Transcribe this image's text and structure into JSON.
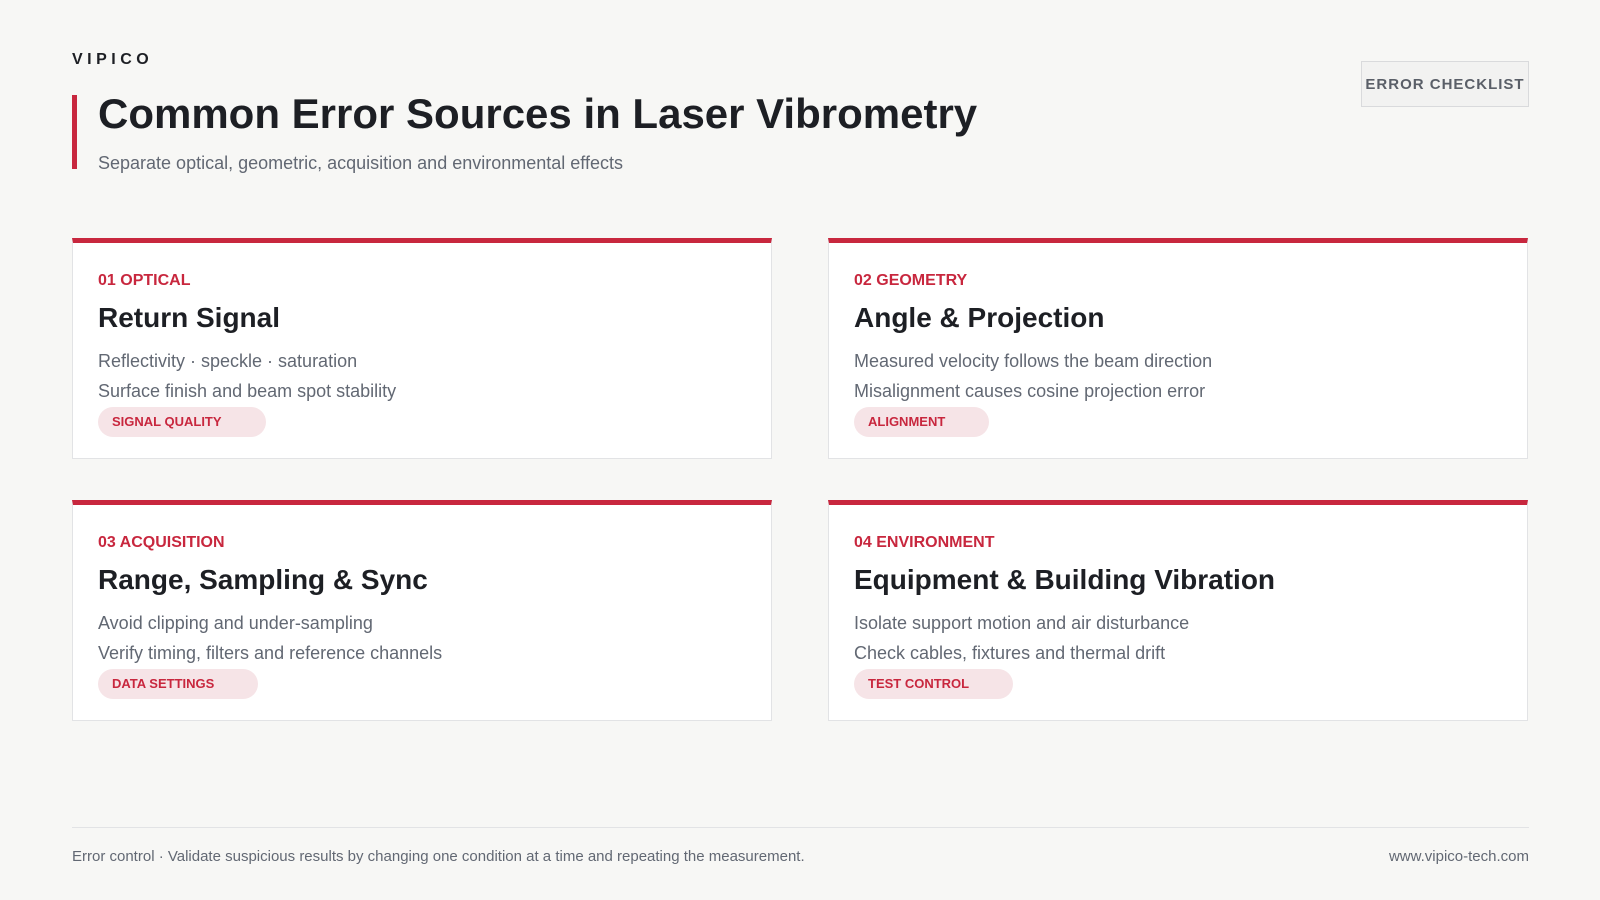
{
  "header": {
    "brand": "VIPICO",
    "title": "Common Error Sources in Laser Vibrometry",
    "subtitle": "Separate optical, geometric, acquisition and environmental effects",
    "checklist_label": "ERROR CHECKLIST"
  },
  "cards": [
    {
      "kicker": "01 OPTICAL",
      "title": "Return Signal",
      "lines": [
        "Reflectivity · speckle · saturation",
        "Surface finish and beam spot stability"
      ],
      "tag": "SIGNAL QUALITY"
    },
    {
      "kicker": "02 GEOMETRY",
      "title": "Angle & Projection",
      "lines": [
        "Measured velocity follows the beam direction",
        "Misalignment causes cosine projection error"
      ],
      "tag": "ALIGNMENT"
    },
    {
      "kicker": "03 ACQUISITION",
      "title": "Range, Sampling & Sync",
      "lines": [
        "Avoid clipping and under-sampling",
        "Verify timing, filters and reference channels"
      ],
      "tag": "DATA SETTINGS"
    },
    {
      "kicker": "04 ENVIRONMENT",
      "title": "Equipment & Building Vibration",
      "lines": [
        "Isolate support motion and air disturbance",
        "Check cables, fixtures and thermal drift"
      ],
      "tag": "TEST CONTROL"
    }
  ],
  "footer": {
    "note": "Error control · Validate suspicious results by changing one condition at a time and repeating the measurement.",
    "url": "www.vipico-tech.com"
  },
  "colors": {
    "accent": "#c8273e",
    "tag_bg": "#f6e4e7",
    "background": "#f7f7f5",
    "text": "#1d1f24",
    "muted": "#626873"
  }
}
